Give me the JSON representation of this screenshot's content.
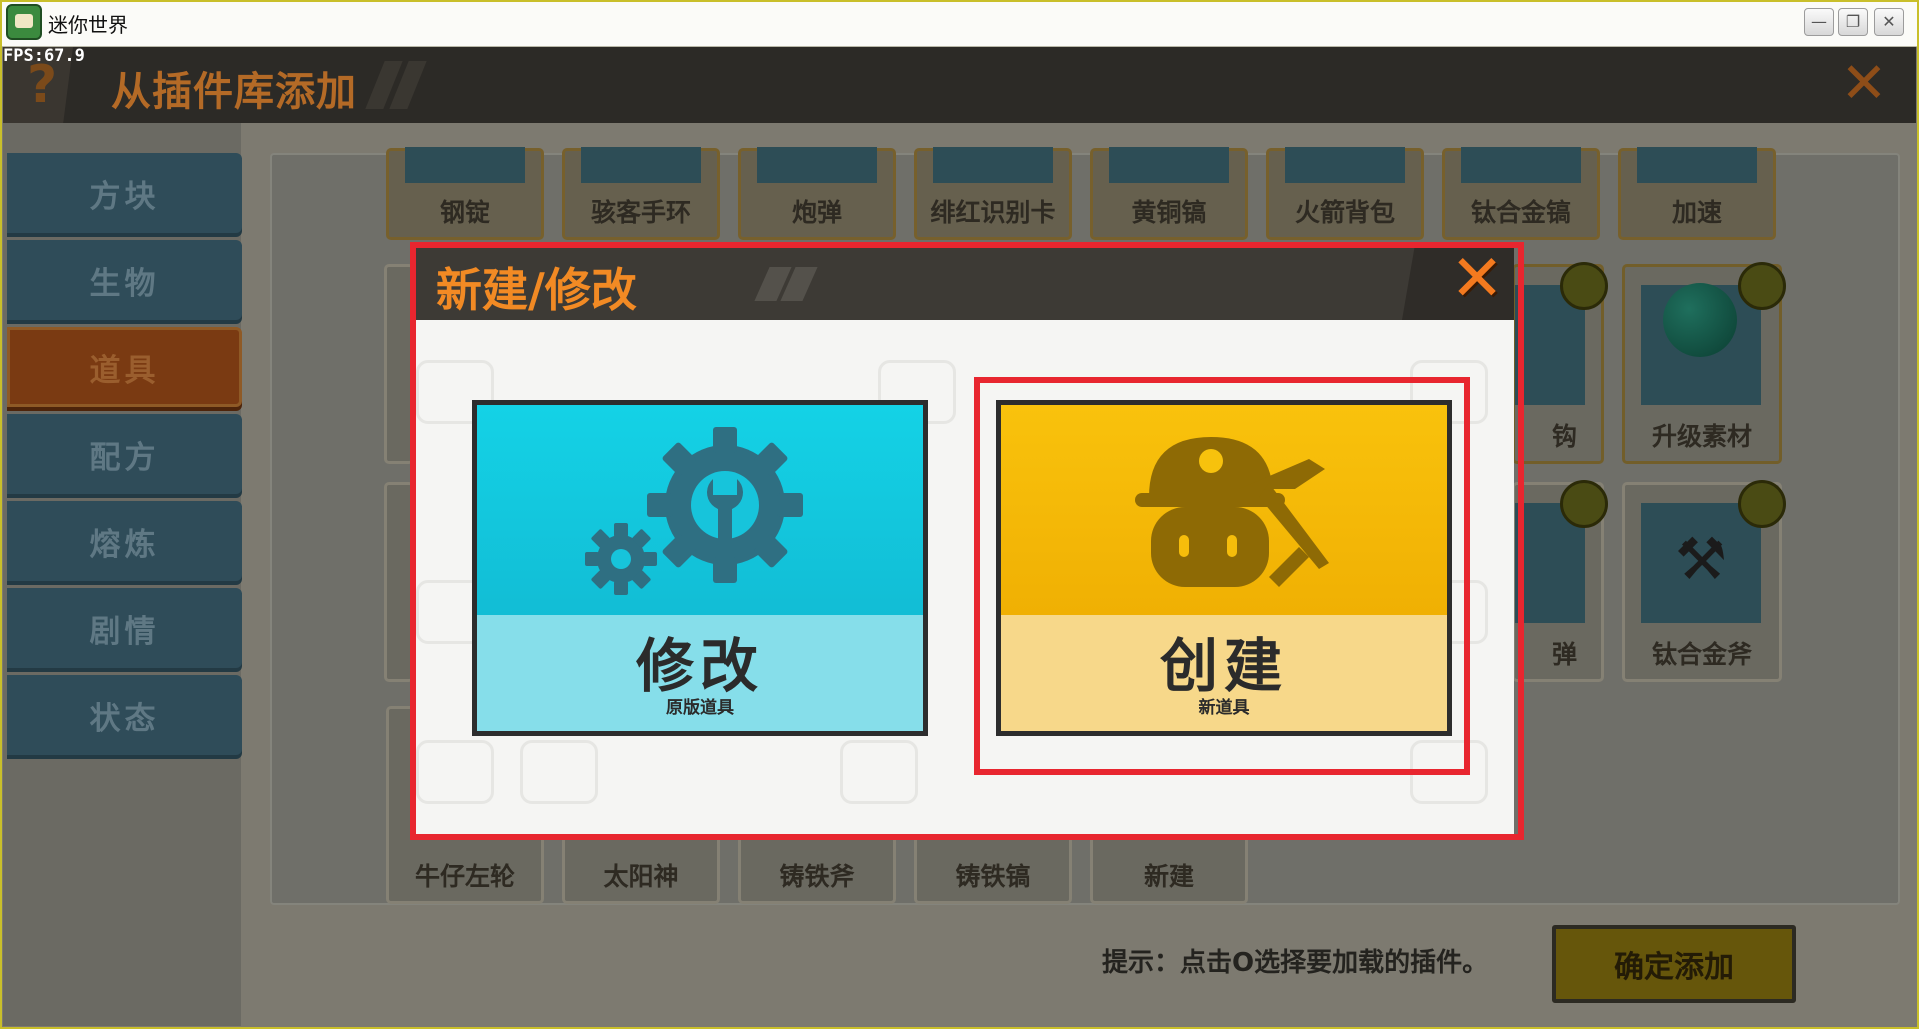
{
  "window": {
    "title": "迷你世界",
    "fps": "FPS:67.9"
  },
  "header": {
    "help_icon": "?",
    "title": "从插件库添加",
    "close_icon": "✕"
  },
  "sidebar": {
    "items": [
      {
        "label": "方块",
        "active": false
      },
      {
        "label": "生物",
        "active": false
      },
      {
        "label": "道具",
        "active": true
      },
      {
        "label": "配方",
        "active": false
      },
      {
        "label": "熔炼",
        "active": false
      },
      {
        "label": "剧情",
        "active": false
      },
      {
        "label": "状态",
        "active": false
      }
    ]
  },
  "items_grid": {
    "top_row": [
      "钢锭",
      "骇客手环",
      "炮弹",
      "绯红识别卡",
      "黄铜镐",
      "火箭背包",
      "钛合金镐",
      "加速"
    ],
    "right_column": [
      "钩",
      "升级素材",
      "弹",
      "钛合金斧"
    ],
    "bottom_row": [
      "牛仔左轮",
      "太阳神",
      "铸铁斧",
      "铸铁镐",
      "新建"
    ]
  },
  "footer": {
    "hint": "提示：点击O选择要加载的插件。",
    "confirm_label": "确定添加"
  },
  "dialog": {
    "title": "新建/修改",
    "close_icon": "✕",
    "options": {
      "modify": {
        "title": "修改",
        "subtitle": "原版道具",
        "icon": "gears-wrench-icon"
      },
      "create": {
        "title": "创建",
        "subtitle": "新道具",
        "icon": "miner-pickaxe-icon"
      }
    }
  },
  "colors": {
    "accent_orange": "#f28a24",
    "highlight_red": "#e8262f",
    "modify_cyan": "#15cbe0",
    "create_yellow": "#f6bd0b"
  }
}
